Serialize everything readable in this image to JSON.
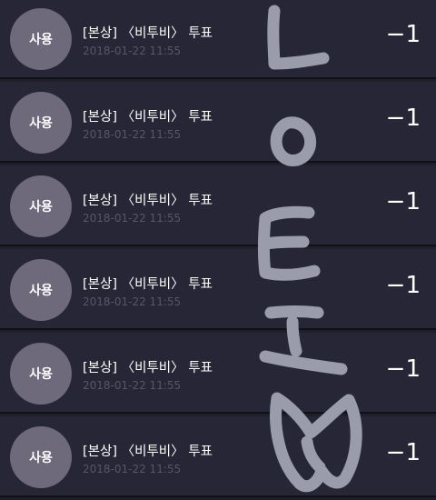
{
  "rows": [
    {
      "avatar_text": "사용",
      "title": "[본상] 〈비투비〉 투표",
      "date": "2018-01-22 11:55",
      "amount": "−1"
    },
    {
      "avatar_text": "사용",
      "title": "[본상] 〈비투비〉 투표",
      "date": "2018-01-22 11:55",
      "amount": "−1"
    },
    {
      "avatar_text": "사용",
      "title": "[본상] 〈비투비〉 투표",
      "date": "2018-01-22 11:55",
      "amount": "−1"
    },
    {
      "avatar_text": "사용",
      "title": "[본상] 〈비투비〉 투표",
      "date": "2018-01-22 11:55",
      "amount": "−1"
    },
    {
      "avatar_text": "사용",
      "title": "[본상] 〈비투비〉 투표",
      "date": "2018-01-22 11:55",
      "amount": "−1"
    },
    {
      "avatar_text": "사용",
      "title": "[본상] 〈비투비〉 투표",
      "date": "2018-01-22 11:55",
      "amount": "−1"
    }
  ],
  "colors": {
    "background": "#1f1f2a",
    "row_background": "#262637",
    "avatar": "#6e6a7b",
    "date_text": "#585666",
    "scribble": "#9a9bab"
  }
}
